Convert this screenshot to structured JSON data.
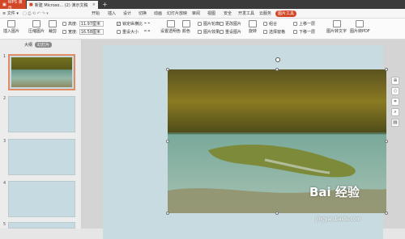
{
  "titlebar": {
    "app_name": "WPS 演示",
    "doc_tab": "新建 Microso... (2) 演示文稿",
    "close": "×",
    "new_tab": "+"
  },
  "menu": {
    "file": "文件",
    "items": [
      "开始",
      "插入",
      "设计",
      "切换",
      "动画",
      "幻灯片放映",
      "审阅",
      "视图",
      "安全",
      "开发工具",
      "云服务",
      "图片工具"
    ],
    "active": "图片工具"
  },
  "ribbon": {
    "insert_picture": "插入图片",
    "compress": "压缩图片",
    "crop": "裁剪",
    "height_label": "高度:",
    "height_value": "11.97厘米",
    "width_label": "宽度:",
    "width_value": "16.58厘米",
    "lock_ratio": "锁定纵横比",
    "reset_size": "重设大小",
    "set_transparent": "设置透明色",
    "color": "颜色",
    "picture_outline": "图片轮廓",
    "picture_effect": "图片效果",
    "change_picture": "更改图片",
    "reset_picture": "重设图片",
    "rotate": "旋转",
    "combine": "组合",
    "select_pane": "选择窗格",
    "bring_forward": "上移一层",
    "send_backward": "下移一层",
    "picture_to_text": "图片转文字",
    "picture_to_pdf": "图片转PDF"
  },
  "panel": {
    "tab_outline": "大纲",
    "tab_slides": "幻灯片",
    "slides": [
      "1",
      "2",
      "3",
      "4",
      "5"
    ]
  },
  "float_tools": [
    "⊕",
    "◇",
    "⌗",
    "⌕",
    "▤"
  ],
  "watermark": {
    "brand": "Bai 经验",
    "url": "jingyan.baidu.com"
  },
  "colors": {
    "accent": "#d24726",
    "slide_bg": "#c7dbe0"
  }
}
